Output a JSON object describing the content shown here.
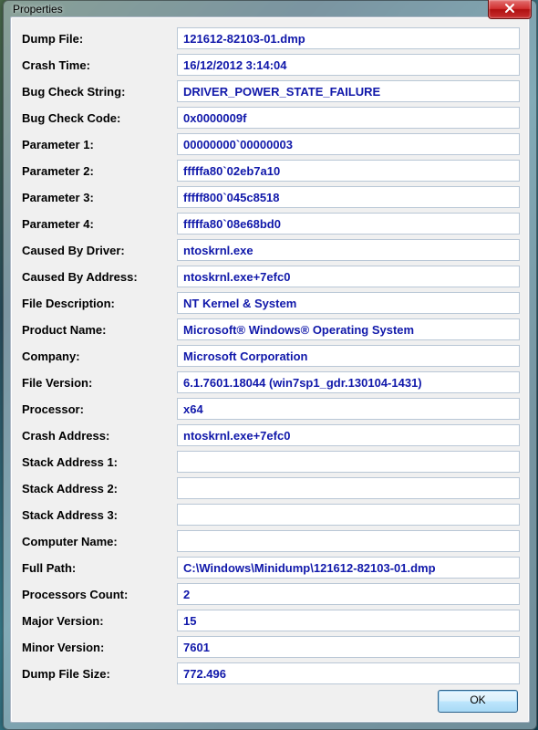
{
  "window": {
    "title": "Properties",
    "ok_label": "OK"
  },
  "fields": [
    {
      "label": "Dump File:",
      "value": "121612-82103-01.dmp"
    },
    {
      "label": "Crash Time:",
      "value": "16/12/2012 3:14:04"
    },
    {
      "label": "Bug Check String:",
      "value": "DRIVER_POWER_STATE_FAILURE"
    },
    {
      "label": "Bug Check Code:",
      "value": "0x0000009f"
    },
    {
      "label": "Parameter 1:",
      "value": "00000000`00000003"
    },
    {
      "label": "Parameter 2:",
      "value": "fffffa80`02eb7a10"
    },
    {
      "label": "Parameter 3:",
      "value": "fffff800`045c8518"
    },
    {
      "label": "Parameter 4:",
      "value": "fffffa80`08e68bd0"
    },
    {
      "label": "Caused By Driver:",
      "value": "ntoskrnl.exe"
    },
    {
      "label": "Caused By Address:",
      "value": "ntoskrnl.exe+7efc0"
    },
    {
      "label": "File Description:",
      "value": "NT Kernel & System"
    },
    {
      "label": "Product Name:",
      "value": "Microsoft® Windows® Operating System"
    },
    {
      "label": "Company:",
      "value": "Microsoft Corporation"
    },
    {
      "label": "File Version:",
      "value": "6.1.7601.18044 (win7sp1_gdr.130104-1431)"
    },
    {
      "label": "Processor:",
      "value": "x64"
    },
    {
      "label": "Crash Address:",
      "value": "ntoskrnl.exe+7efc0"
    },
    {
      "label": "Stack Address 1:",
      "value": ""
    },
    {
      "label": "Stack Address 2:",
      "value": ""
    },
    {
      "label": "Stack Address 3:",
      "value": ""
    },
    {
      "label": "Computer Name:",
      "value": ""
    },
    {
      "label": "Full Path:",
      "value": "C:\\Windows\\Minidump\\121612-82103-01.dmp"
    },
    {
      "label": "Processors Count:",
      "value": "2"
    },
    {
      "label": "Major Version:",
      "value": "15"
    },
    {
      "label": "Minor Version:",
      "value": "7601"
    },
    {
      "label": "Dump File Size:",
      "value": "772.496"
    }
  ]
}
